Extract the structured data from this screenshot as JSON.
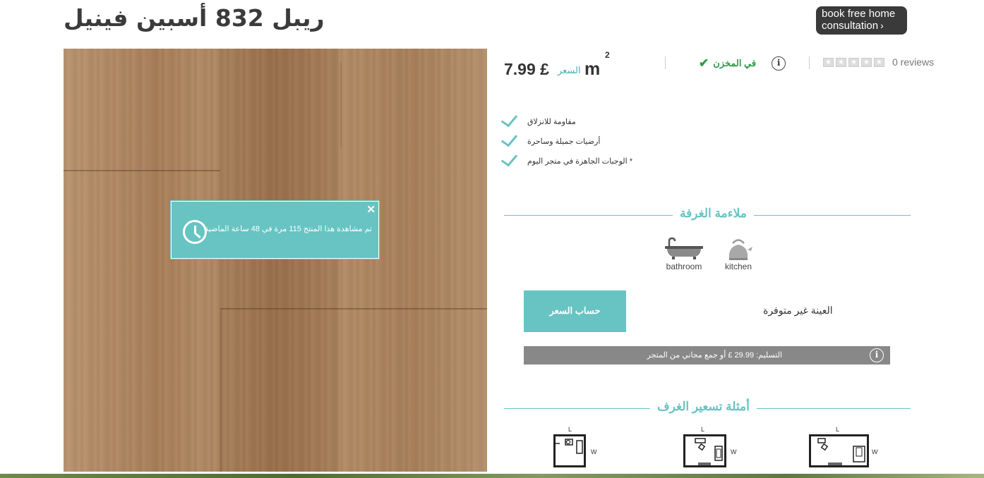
{
  "product": {
    "title": "ريبل 832 أسبين فينيل"
  },
  "consultation": {
    "line1": "book free home",
    "line2": "consultation",
    "chevron": "›"
  },
  "popup": {
    "message": "تم مشاهدة هذا المنتج 115 مرة في 48 ساعة الماضية",
    "close": "✕",
    "icon": "clock-icon"
  },
  "price": {
    "amount": "7.99 £",
    "label": "السعر",
    "unit": "m",
    "unit_power": "2"
  },
  "stock": {
    "text": "في المخزن",
    "check": "✔",
    "info": "i"
  },
  "rating": {
    "stars_filled": 0,
    "stars_total": 5,
    "reviews": "0 reviews"
  },
  "features": [
    {
      "text": "مقاومة للانزلاق"
    },
    {
      "text": "أرضيات جميلة وساحرة"
    },
    {
      "text": "* الوجبات الجاهزة في متجر اليوم"
    }
  ],
  "room_suitability": {
    "heading": "ملاءمة الغرفة",
    "rooms": [
      {
        "label": "bathroom",
        "icon": "bathtub-icon"
      },
      {
        "label": "kitchen",
        "icon": "kettle-icon"
      }
    ]
  },
  "actions": {
    "calculate": "حساب السعر",
    "sample": "العينة غير متوفرة"
  },
  "delivery": {
    "text": "التسليم: 29.99 £ أو جمع مجاني من المتجر",
    "info": "i"
  },
  "room_pricing": {
    "heading": "أمثلة تسعير الغرف",
    "plans": [
      {
        "length_label": "L",
        "width_label": "W"
      },
      {
        "length_label": "L",
        "width_label": "W"
      },
      {
        "length_label": "L",
        "width_label": "W"
      }
    ]
  },
  "colors": {
    "accent": "#67c4c2",
    "in_stock": "#2d9b48",
    "delivery_bar": "#888888",
    "button_dark": "#3a3a3a"
  }
}
